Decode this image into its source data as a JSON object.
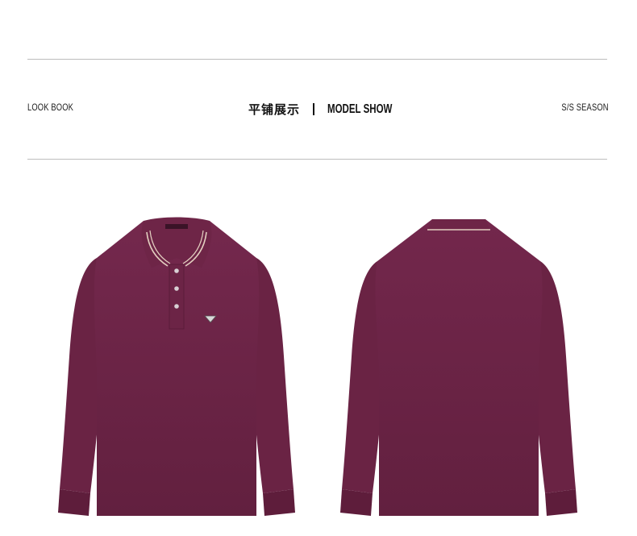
{
  "header": {
    "left_label": "LOOK BOOK",
    "center_title_cn": "平铺展示",
    "center_title_en": "MODEL SHOW",
    "right_label": "S/S SEASON"
  },
  "products": {
    "color_hex": "#6b2346",
    "collar_stripe_hex": "#e3cfc0",
    "items": [
      {
        "view": "front"
      },
      {
        "view": "back"
      }
    ]
  }
}
